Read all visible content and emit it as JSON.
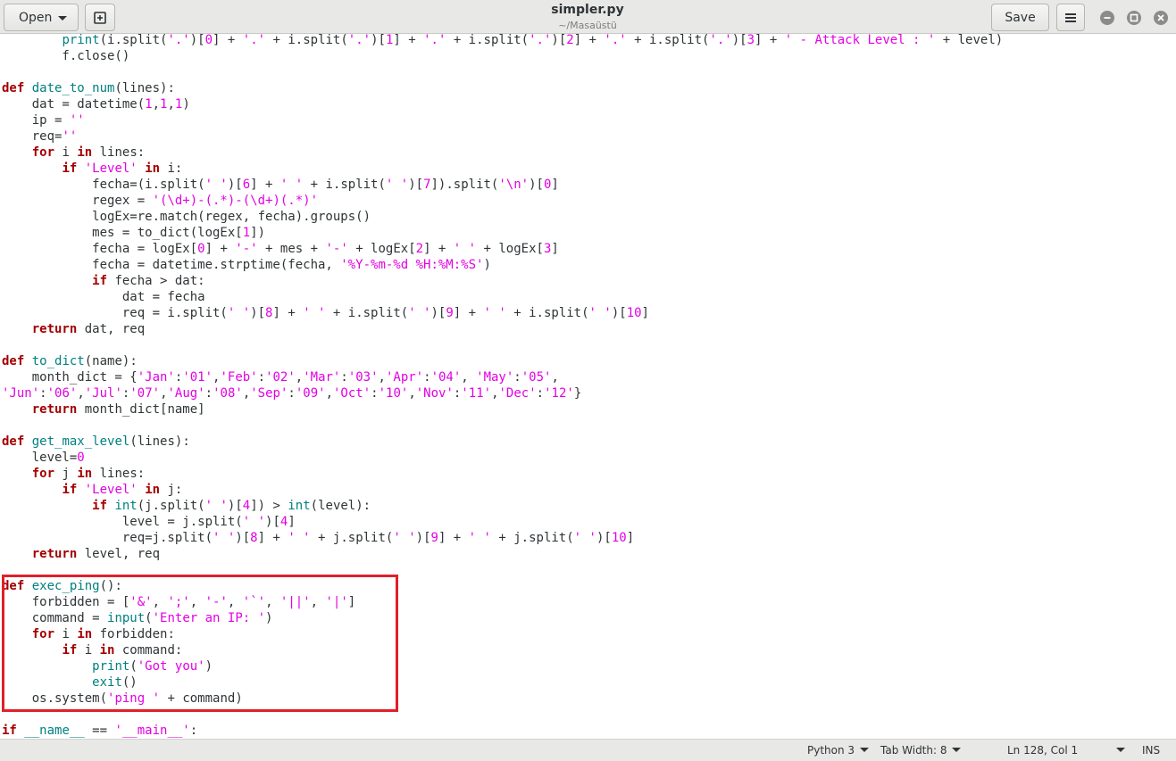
{
  "window": {
    "title": "simpler.py",
    "subtitle": "~/Masaüstü"
  },
  "header": {
    "open_label": "Open",
    "save_label": "Save"
  },
  "statusbar": {
    "language": "Python 3",
    "tab_width": "Tab Width: 8",
    "cursor_position": "Ln 128, Col 1",
    "insert_mode": "INS"
  },
  "icons": [
    "new-tab-icon",
    "hamburger-menu-icon",
    "minimize-icon",
    "maximize-icon",
    "close-icon",
    "chevron-down-icon"
  ],
  "colors": {
    "keyword": "#a40000",
    "function_name": "#008080",
    "string": "#e300e3",
    "highlight_box": "#e0202a"
  },
  "code_lines": [
    "        print(i.split('.')[0] + '.' + i.split('.')[1] + '.' + i.split('.')[2] + '.' + i.split('.')[3] + ' - Attack Level : ' + level)",
    "        f.close()",
    "",
    "def date_to_num(lines):",
    "    dat = datetime(1,1,1)",
    "    ip = ''",
    "    req=''",
    "    for i in lines:",
    "        if 'Level' in i:",
    "            fecha=(i.split(' ')[6] + ' ' + i.split(' ')[7]).split('\\n')[0]",
    "            regex = '(\\d+)-(.*)-(\\d+)(.*)'",
    "            logEx=re.match(regex, fecha).groups()",
    "            mes = to_dict(logEx[1])",
    "            fecha = logEx[0] + '-' + mes + '-' + logEx[2] + ' ' + logEx[3]",
    "            fecha = datetime.strptime(fecha, '%Y-%m-%d %H:%M:%S')",
    "            if fecha > dat:",
    "                dat = fecha",
    "                req = i.split(' ')[8] + ' ' + i.split(' ')[9] + ' ' + i.split(' ')[10]",
    "    return dat, req",
    "",
    "def to_dict(name):",
    "    month_dict = {'Jan':'01','Feb':'02','Mar':'03','Apr':'04', 'May':'05',",
    "'Jun':'06','Jul':'07','Aug':'08','Sep':'09','Oct':'10','Nov':'11','Dec':'12'}",
    "    return month_dict[name]",
    "",
    "def get_max_level(lines):",
    "    level=0",
    "    for j in lines:",
    "        if 'Level' in j:",
    "            if int(j.split(' ')[4]) > int(level):",
    "                level = j.split(' ')[4]",
    "                req=j.split(' ')[8] + ' ' + j.split(' ')[9] + ' ' + j.split(' ')[10]",
    "    return level, req",
    "",
    "def exec_ping():",
    "    forbidden = ['&', ';', '-', '`', '||', '|']",
    "    command = input('Enter an IP: ')",
    "    for i in forbidden:",
    "        if i in command:",
    "            print('Got you')",
    "            exit()",
    "    os.system('ping ' + command)",
    "",
    "if __name__ == '__main__':"
  ]
}
